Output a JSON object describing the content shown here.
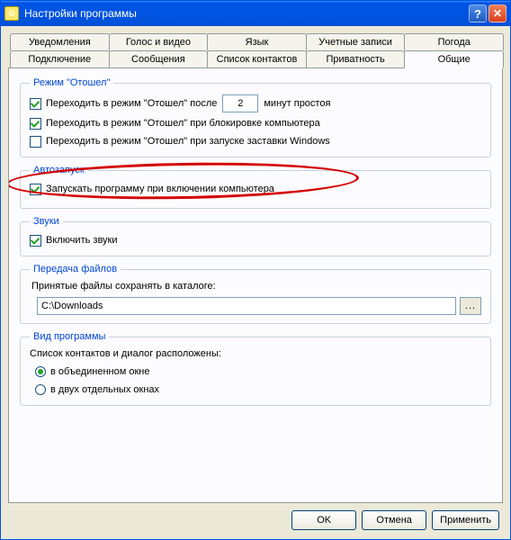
{
  "window": {
    "title": "Настройки программы"
  },
  "tabs_row1": [
    "Уведомления",
    "Голос и видео",
    "Язык",
    "Учетные записи",
    "Погода"
  ],
  "tabs_row2": [
    "Подключение",
    "Сообщения",
    "Список контактов",
    "Приватность",
    "Общие"
  ],
  "active_tab": "Общие",
  "away": {
    "legend": "Режим \"Отошел\"",
    "idle_prefix": "Переходить в режим \"Отошел\" после",
    "idle_value": "2",
    "idle_suffix": "минут простоя",
    "lock": "Переходить в режим \"Отошел\" при блокировке компьютера",
    "screensaver": "Переходить в режим \"Отошел\" при запуске заставки Windows"
  },
  "autostart": {
    "legend": "Автозапуск",
    "run": "Запускать программу при включении компьютера"
  },
  "sounds": {
    "legend": "Звуки",
    "enable": "Включить звуки"
  },
  "files": {
    "legend": "Передача файлов",
    "label": "Принятые файлы сохранять в каталоге:",
    "path": "C:\\Downloads",
    "browse": "..."
  },
  "view": {
    "legend": "Вид программы",
    "label": "Список контактов и диалог расположены:",
    "single": "в объединенном окне",
    "split": "в двух отдельных окнах"
  },
  "buttons": {
    "ok": "OK",
    "cancel": "Отмена",
    "apply": "Применить"
  }
}
